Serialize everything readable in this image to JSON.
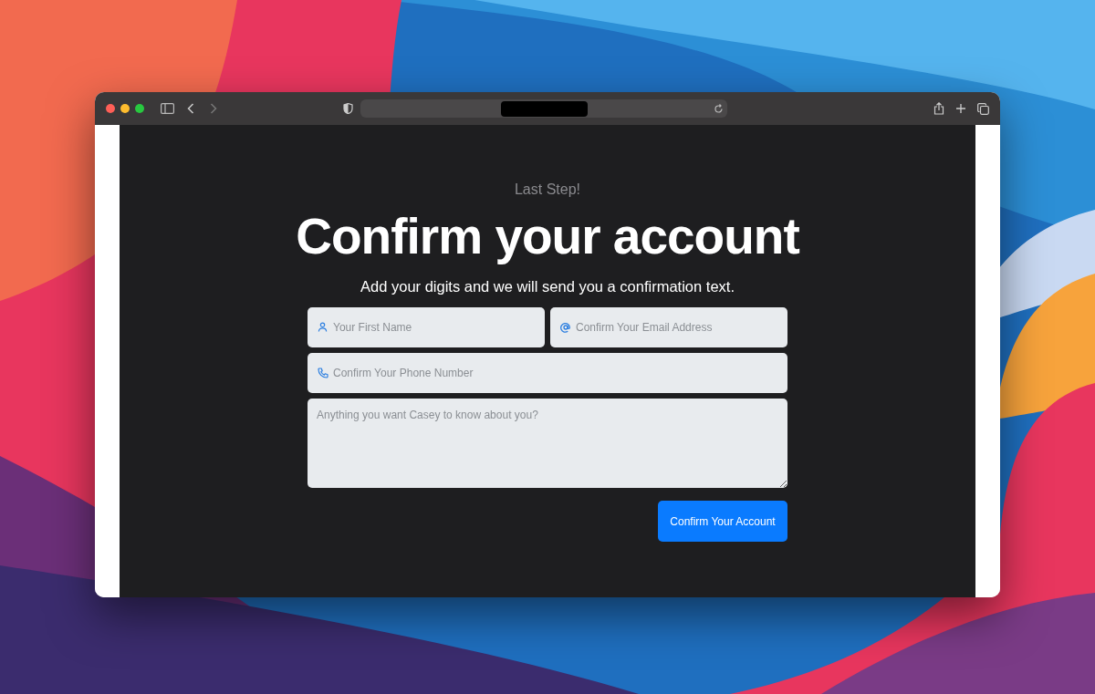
{
  "page": {
    "eyebrow": "Last Step!",
    "title": "Confirm your account",
    "subtitle": "Add your digits and we will send you a confirmation text.",
    "fields": [
      {
        "kind": "name",
        "placeholder": "Your First Name"
      },
      {
        "kind": "email",
        "placeholder": "Confirm Your Email Address"
      },
      {
        "kind": "phone",
        "placeholder": "Confirm Your Phone Number"
      }
    ],
    "message": {
      "placeholder": "Anything you want Casey to know about you?"
    },
    "submit_button": "Confirm Your Account"
  }
}
